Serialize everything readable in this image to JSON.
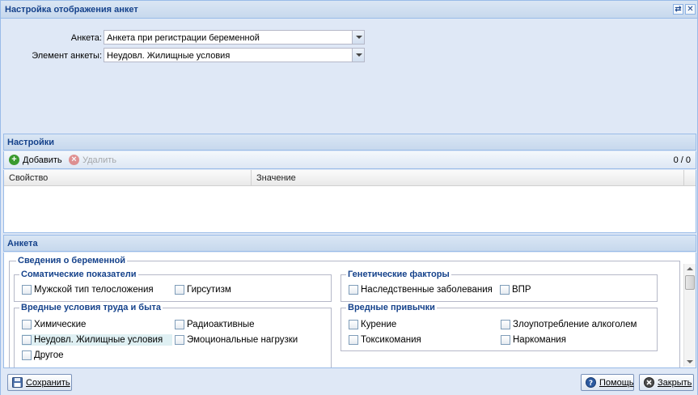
{
  "window": {
    "title": "Настройка отображения анкет"
  },
  "form": {
    "anketa_label": "Анкета:",
    "anketa_value": "Анкета при регистрации беременной",
    "element_label": "Элемент анкеты:",
    "element_value": "Неудовл. Жилищные условия"
  },
  "settings": {
    "title": "Настройки",
    "add_label": "Добавить",
    "delete_label": "Удалить",
    "pager": "0 / 0",
    "columns": [
      "Свойство",
      "Значение"
    ]
  },
  "anketa": {
    "title": "Анкета",
    "section_title": "Сведения о беременной",
    "groups": {
      "somatic": {
        "title": "Соматические показатели",
        "items": [
          "Мужской тип телосложения",
          "Гирсутизм"
        ]
      },
      "genetic": {
        "title": "Генетические факторы",
        "items": [
          "Наследственные заболевания",
          "ВПР"
        ]
      },
      "work": {
        "title": "Вредные условия труда и быта",
        "items": [
          "Химические",
          "Радиоактивные",
          "Неудовл. Жилищные условия",
          "Эмоциональные нагрузки",
          "Другое"
        ]
      },
      "habits": {
        "title": "Вредные привычки",
        "items": [
          "Курение",
          "Злоупотребление алкоголем",
          "Токсикомания",
          "Наркомания"
        ]
      }
    }
  },
  "footer": {
    "save_label": "Сохранить",
    "help_label": "Помощь",
    "close_label": "Закрыть"
  },
  "colors": {
    "header_text": "#15428b",
    "add_icon": "#3a9a2e",
    "delete_icon": "#d9534f",
    "highlight": "#dff0f3"
  }
}
